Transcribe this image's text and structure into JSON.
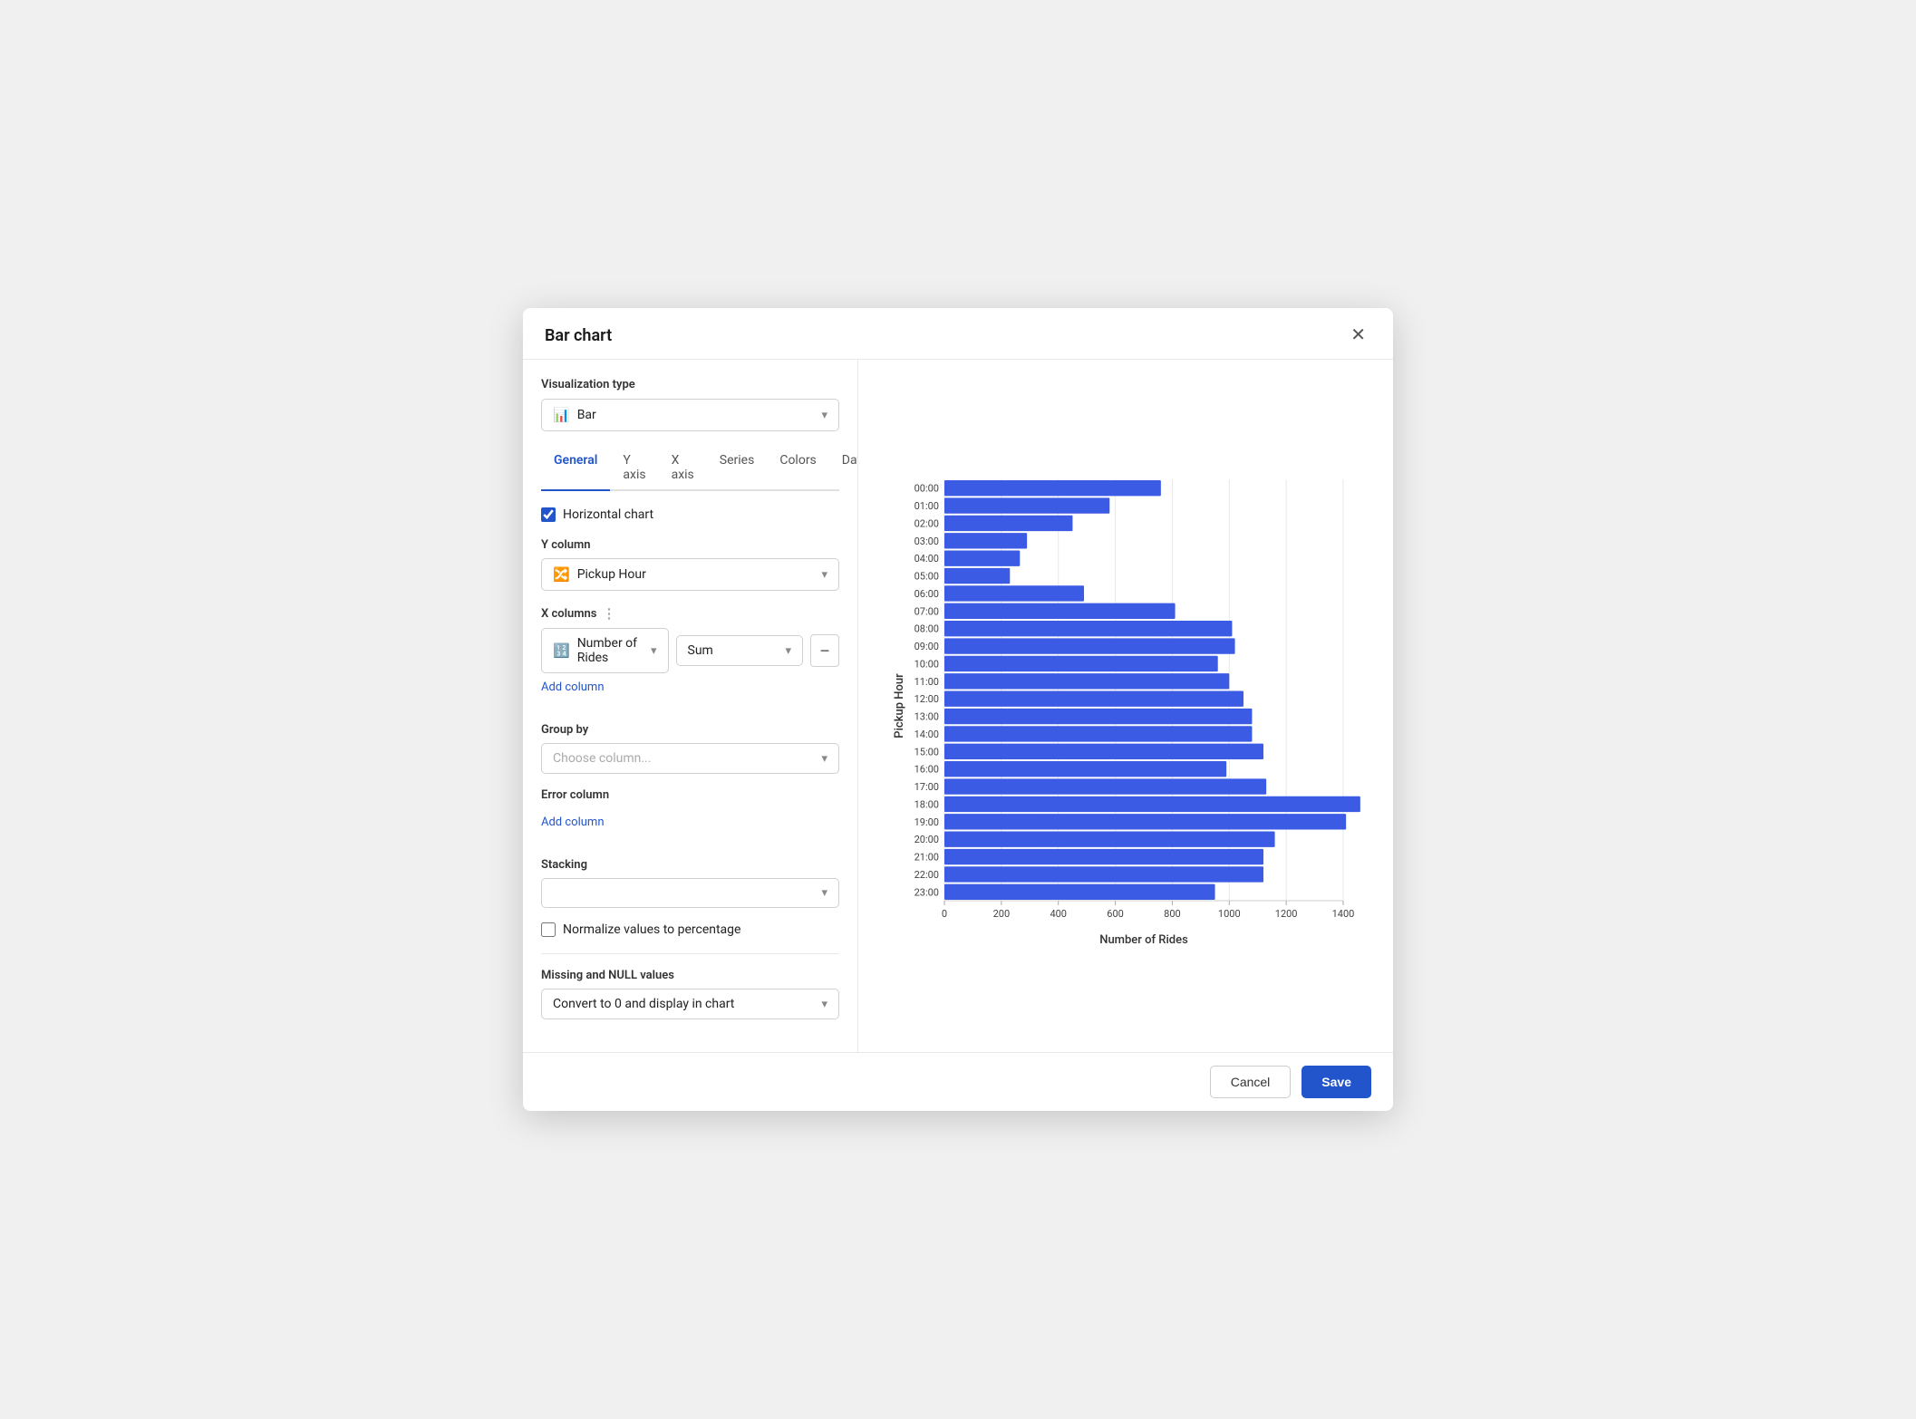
{
  "modal": {
    "title": "Bar chart",
    "close_label": "✕"
  },
  "left": {
    "viz_type_label": "Visualization type",
    "viz_type_value": "Bar",
    "tabs": [
      "General",
      "Y axis",
      "X axis",
      "Series",
      "Colors",
      "Dat",
      "···"
    ],
    "horizontal_label": "Horizontal chart",
    "y_column_label": "Y column",
    "y_column_value": "Pickup Hour",
    "x_columns_label": "X columns",
    "x_col_value": "Number of Rides",
    "x_agg_value": "Sum",
    "add_column_label": "Add column",
    "group_by_label": "Group by",
    "group_by_placeholder": "Choose column...",
    "error_column_label": "Error column",
    "error_add_label": "Add column",
    "stacking_label": "Stacking",
    "normalize_label": "Normalize values to percentage",
    "missing_label": "Missing and NULL values",
    "missing_value": "Convert to 0 and display in chart"
  },
  "chart": {
    "x_axis_label": "Number of Rides",
    "y_axis_label": "Pickup Hour",
    "x_ticks": [
      0,
      200,
      400,
      600,
      800,
      1000,
      1200,
      1400
    ],
    "bars": [
      {
        "label": "00:00",
        "value": 760
      },
      {
        "label": "01:00",
        "value": 580
      },
      {
        "label": "02:00",
        "value": 450
      },
      {
        "label": "03:00",
        "value": 290
      },
      {
        "label": "04:00",
        "value": 265
      },
      {
        "label": "05:00",
        "value": 230
      },
      {
        "label": "06:00",
        "value": 490
      },
      {
        "label": "07:00",
        "value": 810
      },
      {
        "label": "08:00",
        "value": 1010
      },
      {
        "label": "09:00",
        "value": 1020
      },
      {
        "label": "10:00",
        "value": 960
      },
      {
        "label": "11:00",
        "value": 1000
      },
      {
        "label": "12:00",
        "value": 1050
      },
      {
        "label": "13:00",
        "value": 1080
      },
      {
        "label": "14:00",
        "value": 1080
      },
      {
        "label": "15:00",
        "value": 1120
      },
      {
        "label": "16:00",
        "value": 990
      },
      {
        "label": "17:00",
        "value": 1130
      },
      {
        "label": "18:00",
        "value": 1460
      },
      {
        "label": "19:00",
        "value": 1410
      },
      {
        "label": "20:00",
        "value": 1160
      },
      {
        "label": "21:00",
        "value": 1120
      },
      {
        "label": "22:00",
        "value": 1120
      },
      {
        "label": "23:00",
        "value": 950
      }
    ],
    "max_value": 1500,
    "bar_color": "#3b5be5"
  },
  "footer": {
    "cancel_label": "Cancel",
    "save_label": "Save"
  }
}
